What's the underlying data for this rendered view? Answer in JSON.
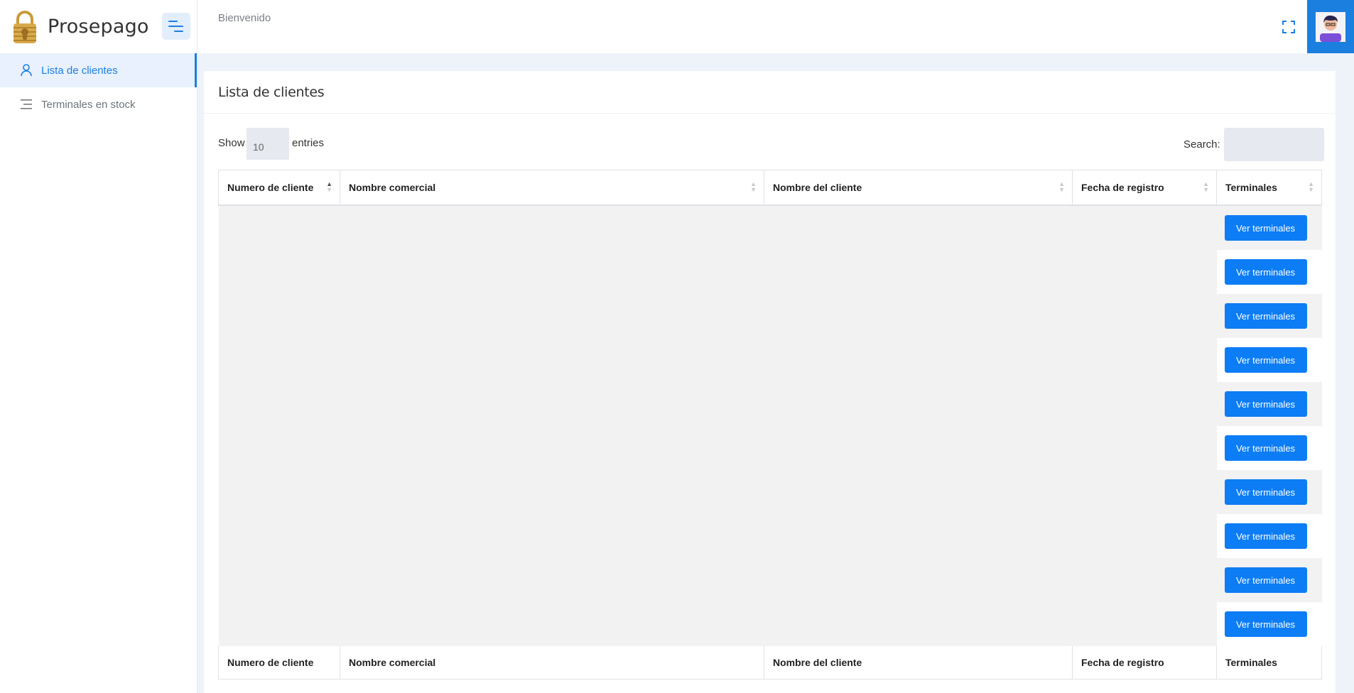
{
  "brand": {
    "name": "Prosepago",
    "logo_icon": "padlock-logo-icon"
  },
  "sidebar": {
    "items": [
      {
        "label": "Lista de clientes",
        "icon": "user-icon",
        "active": true
      },
      {
        "label": "Terminales en stock",
        "icon": "list-icon",
        "active": false
      }
    ]
  },
  "header": {
    "welcome": "Bienvenido",
    "fullscreen_icon": "fullscreen-icon",
    "avatar_icon": "avatar-icon"
  },
  "colors": {
    "accent": "#0d7df5",
    "brand_gold": "#c99a3c",
    "background": "#eef2f9"
  },
  "card": {
    "title": "Lista de clientes"
  },
  "table_controls": {
    "show_label": "Show",
    "entries_value": "10",
    "entries_label": "entries",
    "search_label": "Search:"
  },
  "table": {
    "columns": [
      "Numero de cliente",
      "Nombre comercial",
      "Nombre del cliente",
      "Fecha de registro",
      "Terminales"
    ],
    "rows": [
      {
        "action": "Ver terminales"
      },
      {
        "action": "Ver terminales"
      },
      {
        "action": "Ver terminales"
      },
      {
        "action": "Ver terminales"
      },
      {
        "action": "Ver terminales"
      },
      {
        "action": "Ver terminales"
      },
      {
        "action": "Ver terminales"
      },
      {
        "action": "Ver terminales"
      },
      {
        "action": "Ver terminales"
      },
      {
        "action": "Ver terminales"
      }
    ]
  }
}
